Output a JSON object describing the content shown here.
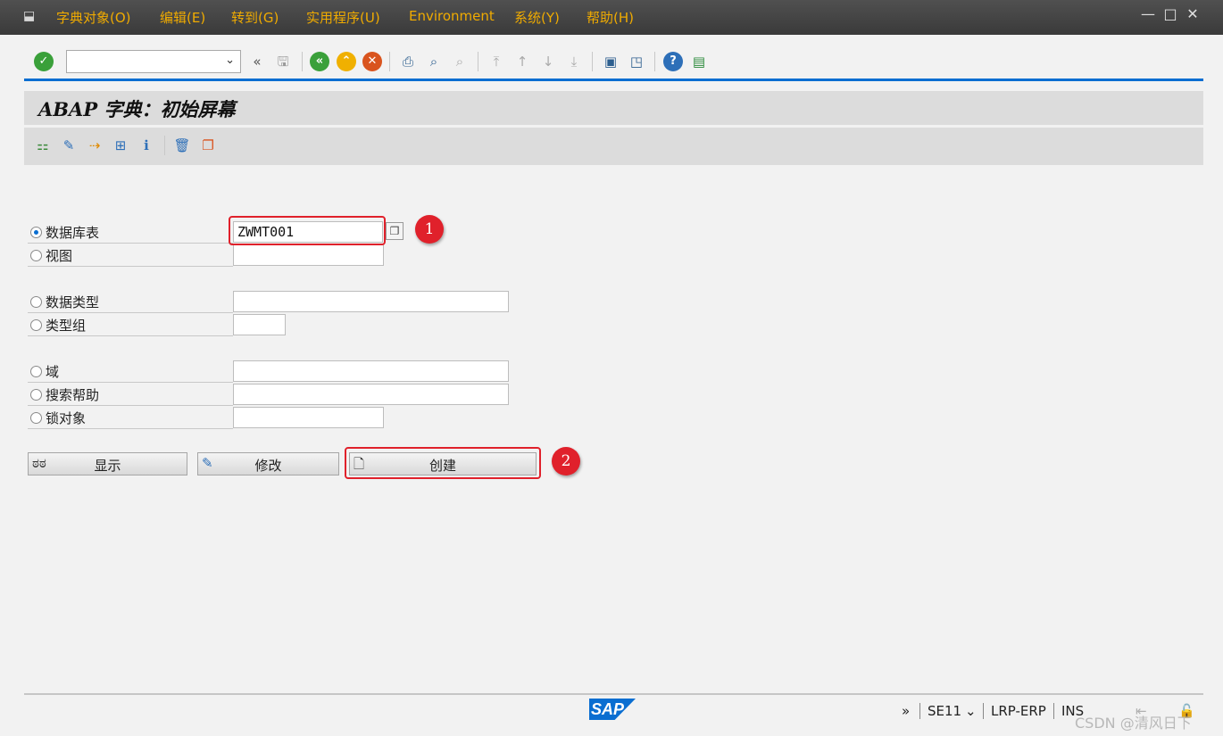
{
  "menu": {
    "items": [
      "字典对象(O)",
      "编辑(E)",
      "转到(G)",
      "实用程序(U)",
      "Environment",
      "系统(Y)",
      "帮助(H)"
    ]
  },
  "window_controls": {
    "minimize": "—",
    "maximize": "□",
    "close": "✕"
  },
  "toolbar": {
    "command_value": "",
    "back_arrows": "«",
    "icons": [
      "enter-icon",
      "save-icon",
      "back-icon",
      "exit-icon",
      "cancel-icon",
      "print-icon",
      "find-icon",
      "find-next-icon",
      "first-page-icon",
      "prev-page-icon",
      "next-page-icon",
      "last-page-icon",
      "new-session-icon",
      "shortcut-icon",
      "help-icon",
      "customize-layout-icon"
    ]
  },
  "title": "ABAP 字典：初始屏幕",
  "app_toolbar": {
    "icons": [
      "other-object-icon",
      "wizard-icon",
      "where-used-icon",
      "hierarchy-icon",
      "info-icon",
      "delete-icon",
      "copy-icon"
    ]
  },
  "form": {
    "options": [
      {
        "label": "数据库表",
        "value": "ZWMT001",
        "selected": true
      },
      {
        "label": "视图",
        "value": "",
        "selected": false
      },
      {
        "label": "数据类型",
        "value": "",
        "selected": false
      },
      {
        "label": "类型组",
        "value": "",
        "selected": false
      },
      {
        "label": "域",
        "value": "",
        "selected": false
      },
      {
        "label": "搜索帮助",
        "value": "",
        "selected": false
      },
      {
        "label": "锁对象",
        "value": "",
        "selected": false
      }
    ]
  },
  "buttons": {
    "display": "显示",
    "change": "修改",
    "create": "创建"
  },
  "annotations": {
    "marker1": "1",
    "marker2": "2"
  },
  "status": {
    "logo": "SAP",
    "expand": "»",
    "transaction": "SE11",
    "system": "LRP-ERP",
    "mode": "INS"
  },
  "watermark": "CSDN @清风日下",
  "colors": {
    "menu_text": "#f0ab00",
    "accent": "#0a6ed1",
    "highlight": "#e0212b"
  }
}
